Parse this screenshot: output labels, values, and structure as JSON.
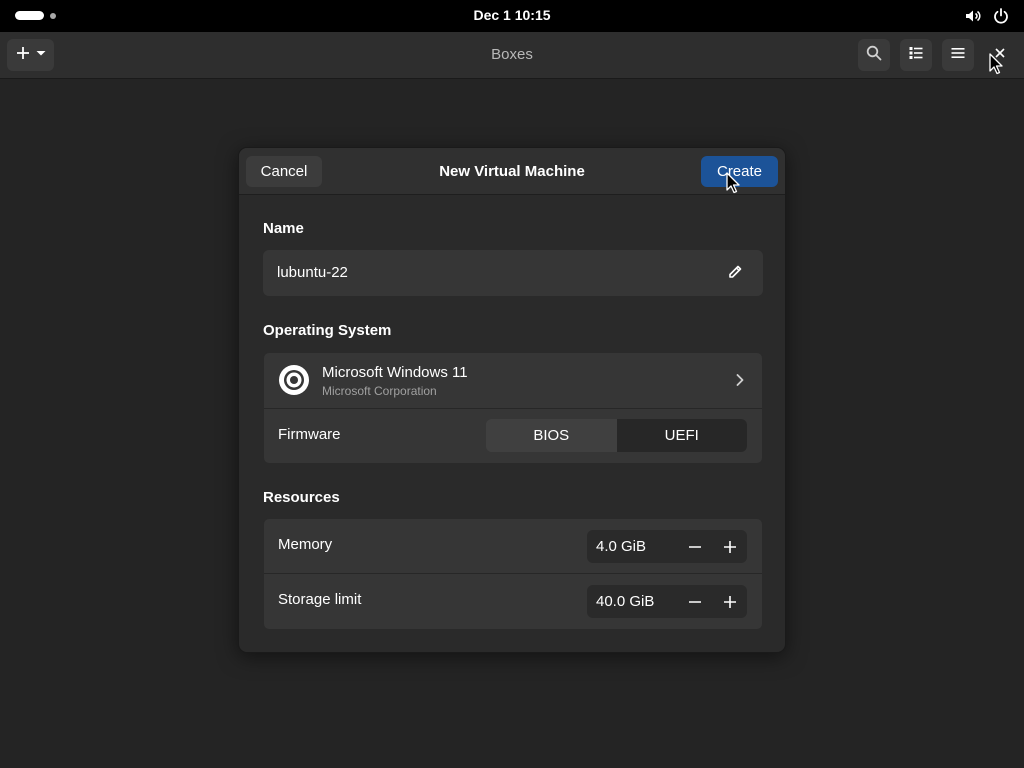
{
  "topbar": {
    "clock": "Dec 1  10:15",
    "icons": [
      "volume-icon",
      "power-icon"
    ]
  },
  "headerbar": {
    "title": "Boxes",
    "new_button_icons": [
      "plus-icon",
      "dropdown-arrow-icon"
    ],
    "right_buttons": [
      "search-icon",
      "list-view-icon",
      "hamburger-menu-icon",
      "close-icon"
    ]
  },
  "dialog": {
    "title": "New Virtual Machine",
    "cancel_label": "Cancel",
    "create_label": "Create",
    "name_section": {
      "label": "Name",
      "value": "lubuntu-22"
    },
    "os_section": {
      "label": "Operating System",
      "os_name": "Microsoft Windows 11",
      "os_vendor": "Microsoft Corporation",
      "firmware_label": "Firmware",
      "firmware_options": [
        "BIOS",
        "UEFI"
      ],
      "firmware_selected": "UEFI"
    },
    "resources_section": {
      "label": "Resources",
      "memory_label": "Memory",
      "memory_value": "4.0 GiB",
      "storage_label": "Storage limit",
      "storage_value": "40.0 GiB"
    }
  },
  "colors": {
    "accent": "#1c5398",
    "background": "#242424",
    "topbar": "#000000"
  }
}
